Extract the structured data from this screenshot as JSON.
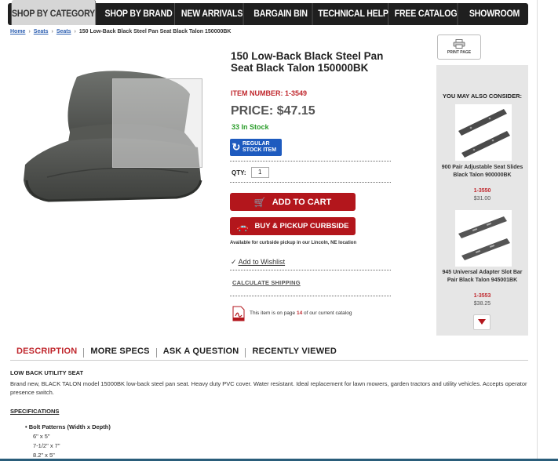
{
  "nav": {
    "items": [
      "SHOP BY CATEGORY",
      "SHOP BY BRAND",
      "NEW ARRIVALS",
      "BARGAIN BIN",
      "TECHNICAL HELP",
      "FREE CATALOG",
      "SHOWROOM"
    ],
    "active_index": 0
  },
  "breadcrumb": {
    "home": "Home",
    "crumb1": "Seats",
    "crumb2": "Seats",
    "current": "150 Low-Back Black Steel Pan Seat Black Talon 150000BK"
  },
  "product": {
    "title": "150 Low-Back Black Steel Pan Seat Black Talon 150000BK",
    "item_number_label": "ITEM NUMBER:",
    "item_number": "1-3549",
    "price_label": "PRICE:",
    "price": "$47.15",
    "stock": "33 In Stock",
    "badge_line1": "REGULAR",
    "badge_line2": "STOCK ITEM",
    "qty_label": "QTY:",
    "qty_value": "1",
    "add_to_cart": "ADD TO CART",
    "curbside": "BUY & PICKUP CURBSIDE",
    "availability": "Available for curbside pickup in our Lincoln, NE location",
    "wishlist_check": "✓",
    "wishlist": "Add to Wishlist",
    "calc_shipping": "CALCULATE SHIPPING",
    "catalog_prefix": "This item is on page",
    "catalog_page": "14",
    "catalog_suffix": "of our current catalog"
  },
  "sidebar": {
    "print_label": "PRINT PAGE",
    "heading": "YOU MAY ALSO CONSIDER:",
    "items": [
      {
        "name": "900 Pair Adjustable Seat Slides Black Talon 900000BK",
        "number": "1-3550",
        "price": "$31.00"
      },
      {
        "name": "945 Universal Adapter Slot Bar Pair Black Talon 945001BK",
        "number": "1-3553",
        "price": "$38.25"
      }
    ]
  },
  "tabs": [
    "DESCRIPTION",
    "MORE SPECS",
    "ASK A QUESTION",
    "RECENTLY VIEWED"
  ],
  "description": {
    "heading": "LOW BACK UTILITY SEAT",
    "body": "Brand new, BLACK TALON model 15000BK low-back steel pan seat. Heavy duty PVC cover. Water resistant. Ideal replacement for lawn mowers, garden tractors and utility vehicles. Accepts operator presence switch.",
    "specs_heading": "SPECIFICATIONS",
    "bolt_patterns_label": "Bolt Patterns (Width x Depth)",
    "bolt_patterns": [
      "6\" x 5\"",
      "7-1/2\" x 7\"",
      "8.2\" x 5\""
    ]
  },
  "colors": {
    "nav_bg": "#1f1f1f",
    "accent_red": "#b3161c",
    "text_red": "#c0272d",
    "stock_green": "#2a9d2a",
    "badge_blue": "#1e5bbf",
    "sidebar_bg": "#e6e6e6"
  }
}
